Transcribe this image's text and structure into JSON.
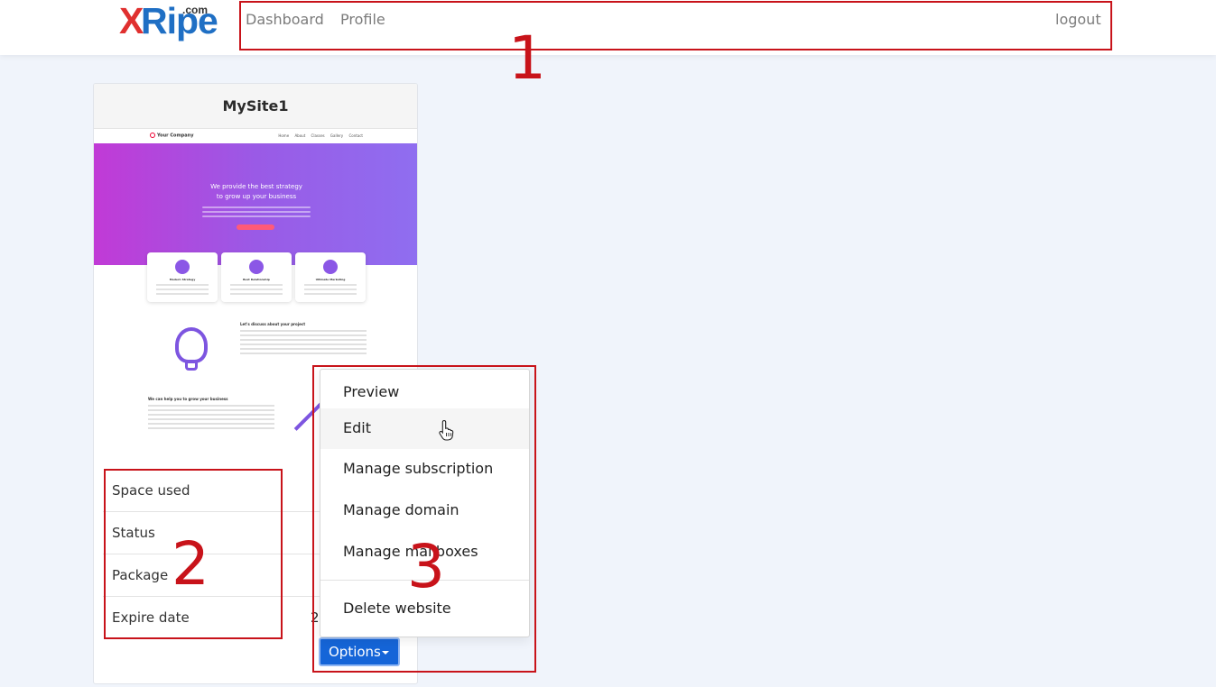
{
  "navbar": {
    "logo": {
      "x_letter": "X",
      "rest": "Ripe",
      "suffix": ".com"
    },
    "links": [
      "Dashboard",
      "Profile"
    ],
    "logout": "logout"
  },
  "annotations": [
    "1",
    "2",
    "3"
  ],
  "site_card": {
    "title": "MySite1",
    "thumbnail": {
      "brand": "Your Company",
      "menu": [
        "Home",
        "About",
        "Classes",
        "Gallery",
        "Contact"
      ],
      "hero_title_1": "We provide the best strategy",
      "hero_title_2": "to grow up your business",
      "features": [
        "Modern Strategy",
        "Best Relationship",
        "Ultimate Marketing"
      ],
      "section1_heading": "Let's discuss about your project",
      "section2_heading": "We can help you to grow your business"
    },
    "info": [
      {
        "label": "Space used",
        "value": ""
      },
      {
        "label": "Status",
        "value": ""
      },
      {
        "label": "Package",
        "value": ""
      },
      {
        "label": "Expire date",
        "value": "20"
      }
    ],
    "options_label": "Options"
  },
  "dropdown": {
    "items": [
      "Preview",
      "Edit",
      "Manage subscription",
      "Manage domain",
      "Manage mailboxes"
    ],
    "danger_item": "Delete website",
    "hovered": "Edit"
  },
  "colors": {
    "accent": "#1565d8",
    "annotation": "#c8131a",
    "logo_red": "#e0302f",
    "logo_blue": "#1f6fc4"
  }
}
